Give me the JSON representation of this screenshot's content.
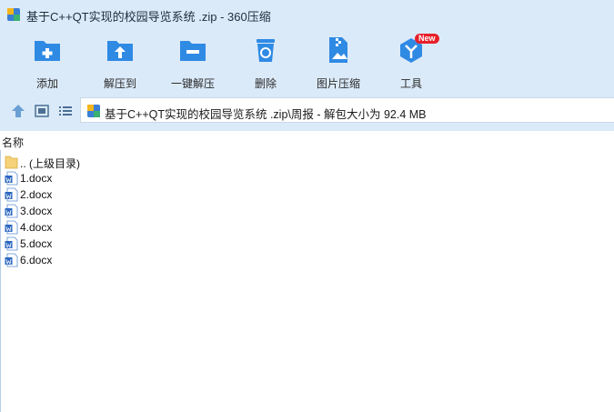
{
  "window": {
    "title": "基于C++QT实现的校园导览系统 .zip - 360压缩"
  },
  "toolbar": {
    "items": [
      {
        "label": "添加",
        "icon": "add-folder-icon"
      },
      {
        "label": "解压到",
        "icon": "extract-to-icon"
      },
      {
        "label": "一键解压",
        "icon": "one-click-extract-icon"
      },
      {
        "label": "删除",
        "icon": "trash-icon"
      },
      {
        "label": "图片压缩",
        "icon": "image-compress-icon"
      },
      {
        "label": "工具",
        "icon": "tools-icon",
        "badge": "New"
      }
    ]
  },
  "address": {
    "path": "基于C++QT实现的校园导览系统 .zip\\周报 - 解包大小为 92.4 MB"
  },
  "list": {
    "column_name": "名称",
    "rows": [
      {
        "name": ".. (上级目录)",
        "icon": "folder-icon"
      },
      {
        "name": "1.docx",
        "icon": "word-doc-icon"
      },
      {
        "name": "2.docx",
        "icon": "word-doc-icon"
      },
      {
        "name": "3.docx",
        "icon": "word-doc-icon"
      },
      {
        "name": "4.docx",
        "icon": "word-doc-icon"
      },
      {
        "name": "5.docx",
        "icon": "word-doc-icon"
      },
      {
        "name": "6.docx",
        "icon": "word-doc-icon"
      }
    ]
  },
  "colors": {
    "accent": "#2f8ae4",
    "chrome_bg": "#dbeaf9",
    "badge": "#e8202a"
  }
}
